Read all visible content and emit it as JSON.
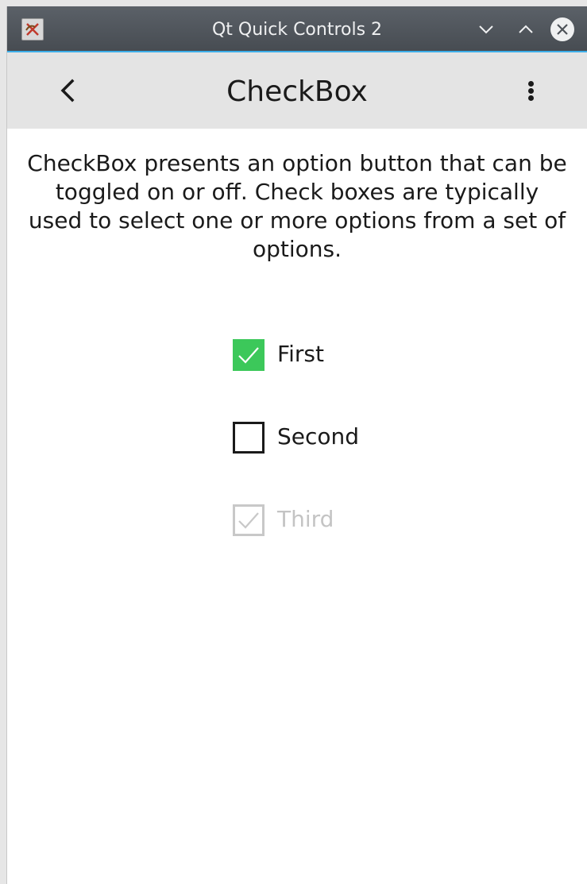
{
  "window": {
    "title": "Qt Quick Controls 2",
    "icon": "qt-app-icon",
    "controls": [
      "minimize-icon",
      "maximize-icon",
      "close-icon"
    ]
  },
  "toolbar": {
    "back_icon": "chevron-left-icon",
    "title": "CheckBox",
    "menu_icon": "kebab-menu-icon"
  },
  "page": {
    "description": "CheckBox presents an option button that can be toggled on or off. Check boxes are typically used to select one or more options from a set of options."
  },
  "checkboxes": [
    {
      "label": "First",
      "checked": true,
      "enabled": true
    },
    {
      "label": "Second",
      "checked": false,
      "enabled": true
    },
    {
      "label": "Third",
      "checked": true,
      "enabled": false
    }
  ],
  "colors": {
    "accent_checked": "#3cc85a",
    "titlebar": "#4f555b",
    "titlebar_accent": "#3daee9",
    "toolbar_bg": "#e4e4e4",
    "disabled": "#c8c8c8"
  }
}
